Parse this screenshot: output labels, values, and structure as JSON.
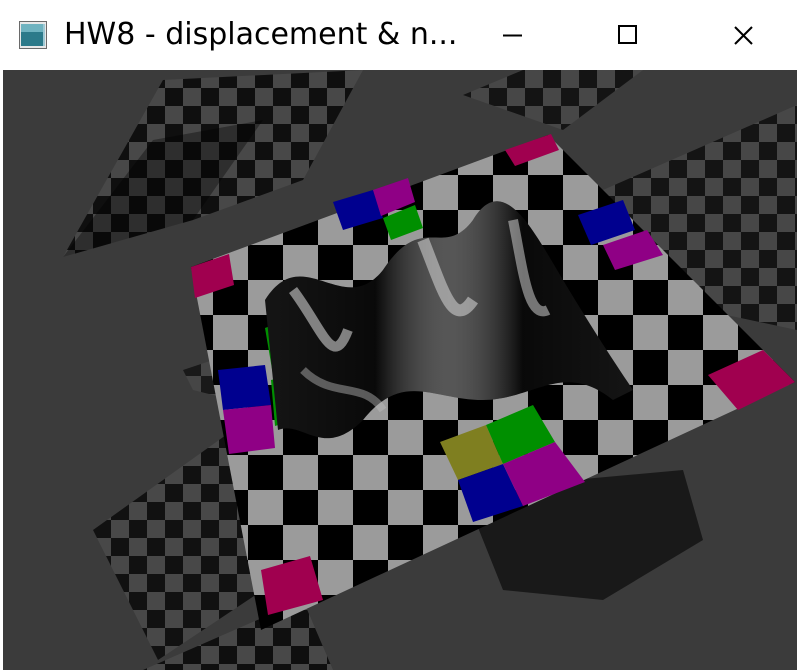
{
  "window": {
    "title": "HW8 - displacement & n...",
    "icon": "application-window-icon",
    "controls": {
      "minimize_icon": "minimize-icon",
      "maximize_icon": "maximize-icon",
      "close_icon": "close-icon"
    }
  },
  "scene": {
    "background_color": "#3b3b3b",
    "checker_light": "#9a9a9a",
    "checker_dark": "#000000",
    "accent_colors": [
      "#a0004f",
      "#00008f",
      "#008f00",
      "#8f0085",
      "#7f7f20"
    ]
  }
}
